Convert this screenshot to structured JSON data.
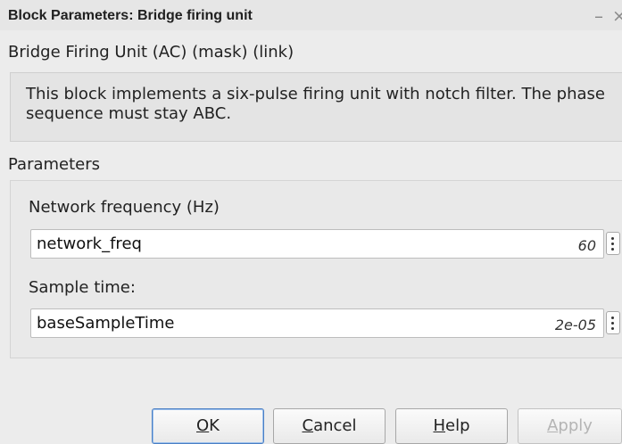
{
  "window": {
    "title": "Block Parameters: Bridge firing unit",
    "minimize_glyph": "–",
    "close_glyph": "×"
  },
  "mask": {
    "title": "Bridge Firing Unit (AC) (mask) (link)",
    "description": "This block implements a six-pulse firing unit with notch filter. The phase sequence must stay ABC."
  },
  "parameters": {
    "section_label": "Parameters",
    "fields": [
      {
        "label": "Network frequency (Hz)",
        "value": "network_freq",
        "evaluated": "60"
      },
      {
        "label": "Sample time:",
        "value": "baseSampleTime",
        "evaluated": "2e-05"
      }
    ]
  },
  "buttons": {
    "ok": {
      "mnemonic": "O",
      "rest": "K"
    },
    "cancel": {
      "mnemonic": "C",
      "rest": "ancel"
    },
    "help": {
      "mnemonic": "H",
      "rest": "elp"
    },
    "apply": {
      "mnemonic": "A",
      "rest": "pply"
    }
  },
  "colors": {
    "default_button_border": "#4a7fc4",
    "disabled_text": "#b4b4b4"
  }
}
